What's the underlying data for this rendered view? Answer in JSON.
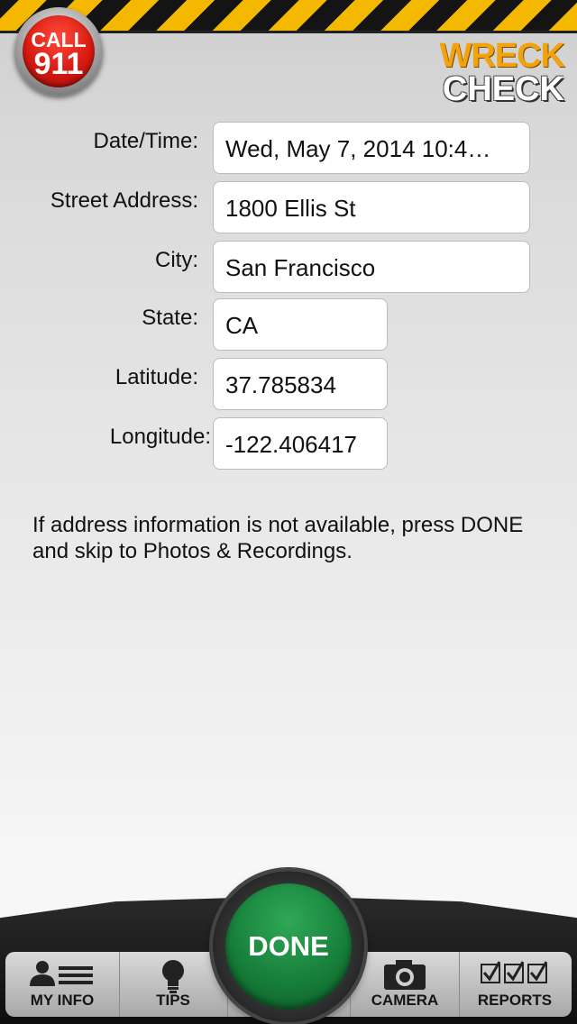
{
  "header": {
    "call_button": {
      "top": "CALL",
      "number": "911"
    },
    "logo": {
      "line1": "WRECK",
      "line2": "CHECK"
    }
  },
  "form": {
    "date_time": {
      "label": "Date/Time:",
      "value": "Wed, May 7, 2014 10:4…"
    },
    "street": {
      "label": "Street Address:",
      "value": "1800 Ellis St"
    },
    "city": {
      "label": "City:",
      "value": "San Francisco"
    },
    "state": {
      "label": "State:",
      "value": "CA"
    },
    "latitude": {
      "label": "Latitude:",
      "value": "37.785834"
    },
    "longitude": {
      "label": "Longitude:",
      "value": "-122.406417"
    }
  },
  "info_text": "If  address information is not available, press DONE and skip to Photos & Recordings.",
  "toolbar": {
    "my_info": "MY INFO",
    "tips": "TIPS",
    "done": "DONE",
    "camera": "CAMERA",
    "reports": "REPORTS"
  },
  "colors": {
    "hazard_yellow": "#f5b800",
    "call_red": "#d81a12",
    "done_green": "#17803b",
    "logo_orange": "#f2a20a"
  }
}
